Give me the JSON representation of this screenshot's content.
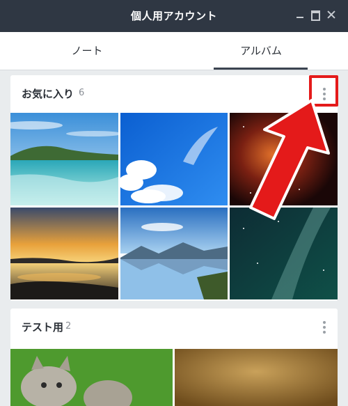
{
  "window": {
    "title": "個人用アカウント"
  },
  "tabs": {
    "note": "ノート",
    "album": "アルバム"
  },
  "albums": [
    {
      "name": "お気に入り",
      "count": "6"
    },
    {
      "name": "テスト用",
      "count": "2"
    }
  ],
  "colors": {
    "titlebar": "#2f3743",
    "highlight": "#e41a1a",
    "background": "#e9ecee"
  },
  "icons": [
    "minimize-icon",
    "maximize-icon",
    "close-icon",
    "more-vertical-icon"
  ]
}
